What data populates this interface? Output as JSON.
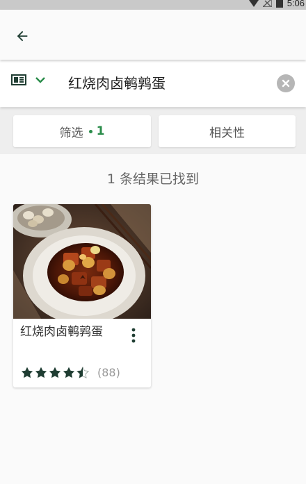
{
  "status_bar": {
    "time": "5:06",
    "icons": [
      "wifi-icon",
      "no-signal-icon",
      "battery-icon"
    ]
  },
  "app_bar": {
    "back_icon": "arrow-back-icon"
  },
  "search": {
    "view_icon": "list-view-icon",
    "dropdown_icon": "chevron-down-icon",
    "query": "红烧肉卤鹌鹑蛋",
    "clear_icon": "clear-icon"
  },
  "filters": {
    "filter_label": "筛选",
    "filter_count": "1",
    "sort_label": "相关性"
  },
  "results_text": "1 条结果已找到",
  "recipes": [
    {
      "title": "红烧肉卤鹌鹑蛋",
      "rating": 4.5,
      "rating_max": 5,
      "reviews": "(88)"
    }
  ],
  "colors": {
    "accent": "#2a8c4a",
    "icon_dark": "#1f3d32",
    "star": "#1f3d32"
  }
}
